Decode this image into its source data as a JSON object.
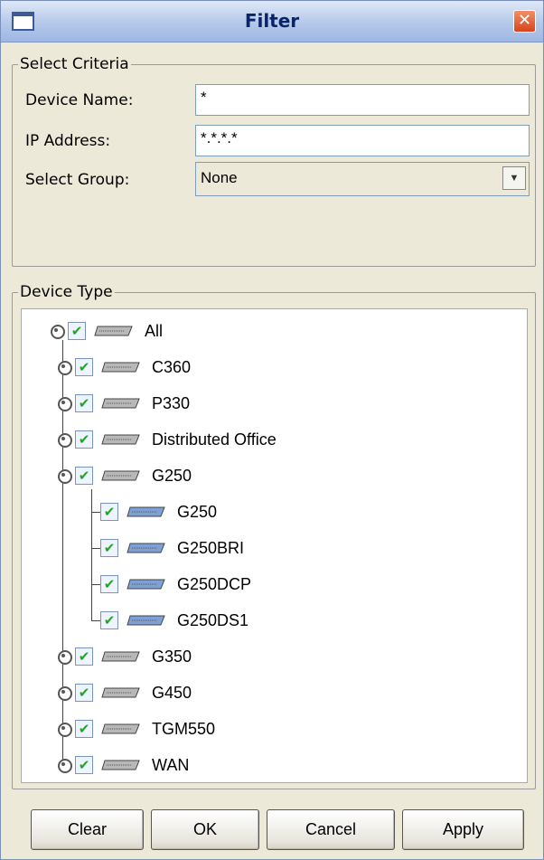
{
  "window": {
    "title": "Filter",
    "close_glyph": "✕",
    "icon": "window-icon"
  },
  "criteria": {
    "legend": "Select Criteria",
    "device_name": {
      "label": "Device Name:",
      "value": "*"
    },
    "ip_address": {
      "label": "IP Address:",
      "value": "*.*.*.*"
    },
    "group": {
      "label": "Select Group:",
      "value": "None",
      "arrow": "▼"
    }
  },
  "device_type": {
    "legend": "Device Type",
    "check_glyph": "✔",
    "items": [
      {
        "label": "All",
        "checked": true,
        "level": 0
      },
      {
        "label": "C360",
        "checked": true,
        "level": 1
      },
      {
        "label": "P330",
        "checked": true,
        "level": 1
      },
      {
        "label": "Distributed Office",
        "checked": true,
        "level": 1
      },
      {
        "label": "G250",
        "checked": true,
        "level": 1
      },
      {
        "label": "G250",
        "checked": true,
        "level": 2
      },
      {
        "label": "G250BRI",
        "checked": true,
        "level": 2
      },
      {
        "label": "G250DCP",
        "checked": true,
        "level": 2
      },
      {
        "label": "G250DS1",
        "checked": true,
        "level": 2
      },
      {
        "label": "G350",
        "checked": true,
        "level": 1
      },
      {
        "label": "G450",
        "checked": true,
        "level": 1
      },
      {
        "label": "TGM550",
        "checked": true,
        "level": 1
      },
      {
        "label": "WAN",
        "checked": true,
        "level": 1
      }
    ]
  },
  "buttons": {
    "clear": "Clear",
    "ok": "OK",
    "cancel": "Cancel",
    "apply": "Apply"
  },
  "colors": {
    "device_gray": "#b8b8b8",
    "device_blue": "#7da0d8",
    "check_green": "#21a621"
  }
}
